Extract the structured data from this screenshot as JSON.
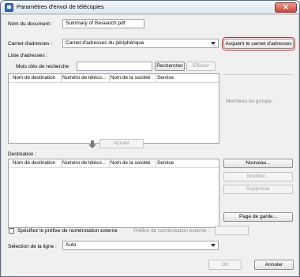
{
  "window": {
    "title": "Paramètres d'envoi de télécopies",
    "close_glyph": "✕"
  },
  "document": {
    "label": "Nom du document :",
    "value": "Summary of Research.pdf"
  },
  "address_book": {
    "label": "Carnet d'adresses :",
    "selected": "Carnet d'adresses du périphérique",
    "acquire_button": "Acquérir le carnet d'adresses"
  },
  "address_list": {
    "label": "Liste d'adresses :",
    "search_label": "Mots clés de recherche",
    "search_value": "",
    "search_button": "Rechercher",
    "clear_button": "Effacer",
    "columns": [
      "Nom de destination",
      "Numéro de téléco...",
      "Nom de la société",
      "Service"
    ]
  },
  "group_members": {
    "label": "Membres du groupe :"
  },
  "add_button": "Ajouter",
  "destination": {
    "label": "Destination :",
    "columns": [
      "Nom de destination",
      "Numéro de téléco...",
      "Nom de la société",
      "Service"
    ],
    "new_button": "Nouveau...",
    "edit_button": "Modifier...",
    "delete_button": "Supprimer",
    "cover_button": "Page de garde..."
  },
  "prefix": {
    "checkbox_label": "Spécifiez le préfixe de numérotation externe",
    "checked": false,
    "field_label": "Préfixe de numérotation externe :",
    "value": ""
  },
  "line": {
    "label": "Sélection de la ligne :",
    "selected": "Auto"
  },
  "footer": {
    "ok_button": "OK",
    "cancel_button": "Annuler"
  }
}
